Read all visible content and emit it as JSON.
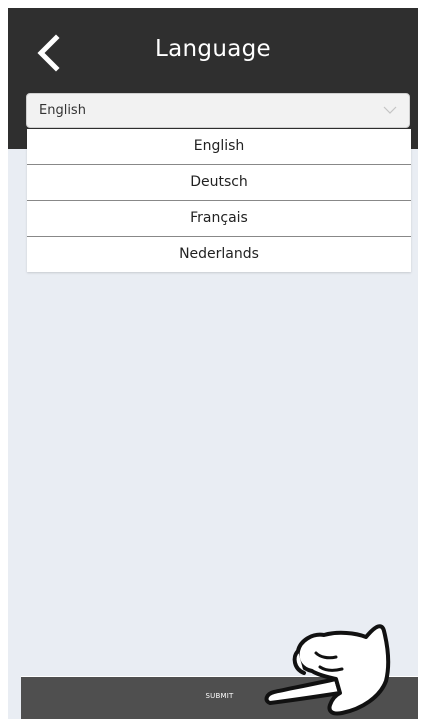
{
  "header": {
    "title": "Language",
    "back_icon": "chevron-left-icon"
  },
  "language_select": {
    "selected": "English",
    "arrow_icon": "chevron-down-icon",
    "options": [
      "English",
      "Deutsch",
      "Français",
      "Nederlands"
    ]
  },
  "footer": {
    "submit_label": "SUBMIT",
    "pointer_icon": "hand-pointer-icon"
  },
  "colors": {
    "header_bg": "#2f2f2f",
    "content_bg": "#e9edf3",
    "button_bg": "#4f4f4f"
  }
}
